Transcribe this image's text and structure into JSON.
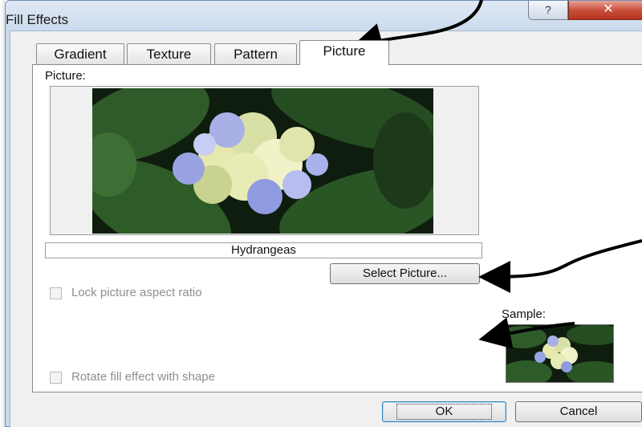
{
  "window": {
    "title": "Fill Effects"
  },
  "caption_buttons": {
    "help": "?",
    "close": "✕"
  },
  "tabs": [
    {
      "label": "Gradient",
      "active": false
    },
    {
      "label": "Texture",
      "active": false
    },
    {
      "label": "Pattern",
      "active": false
    },
    {
      "label": "Picture",
      "active": true
    }
  ],
  "picture": {
    "label": "Picture:",
    "name": "Hydrangeas",
    "select_button": "Select Picture..."
  },
  "options": {
    "lock_aspect": {
      "label": "Lock picture aspect ratio",
      "checked": false,
      "enabled": false
    },
    "rotate_with_shape": {
      "label": "Rotate fill effect with shape",
      "checked": false,
      "enabled": false
    }
  },
  "sample": {
    "label": "Sample:"
  },
  "buttons": {
    "ok": "OK",
    "cancel": "Cancel"
  },
  "colors": {
    "accent": "#3c7fb1",
    "titlebar": "#c9d9ec",
    "close_red": "#c8513d"
  },
  "icons": [
    "help-icon",
    "close-icon"
  ]
}
